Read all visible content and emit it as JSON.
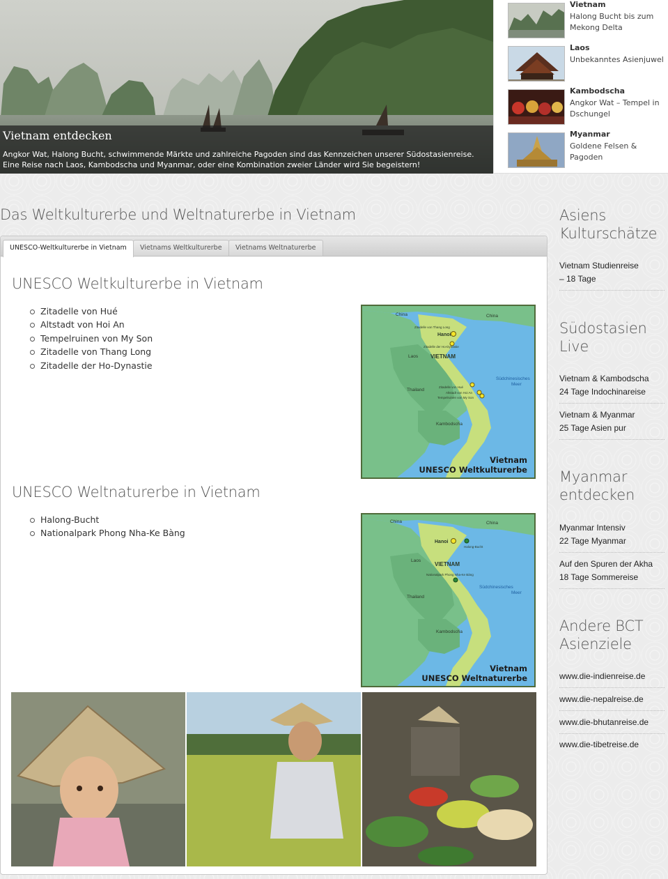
{
  "hero": {
    "title": "Vietnam entdecken",
    "text_line1": "Angkor Wat, Halong Bucht, schwimmende Märkte und zahlreiche Pagoden sind das Kennzeichen unserer Südostasienreise.",
    "text_line2": "Eine Reise nach Laos, Kambodscha und Myanmar, oder eine Kombination zweier Länder wird Sie begeistern!"
  },
  "destinations": [
    {
      "name": "Vietnam",
      "sub": "Halong Bucht bis zum Mekong Delta",
      "thumb": "halong-bay-thumbnail"
    },
    {
      "name": "Laos",
      "sub": "Unbekanntes Asienjuwel",
      "thumb": "laos-temple-thumbnail"
    },
    {
      "name": "Kambodscha",
      "sub": "Angkor Wat – Tempel in Dschungel",
      "thumb": "cambodia-dancers-thumbnail"
    },
    {
      "name": "Myanmar",
      "sub": "Goldene Felsen & Pagoden",
      "thumb": "myanmar-pagoda-thumbnail"
    }
  ],
  "page_title": "Das Weltkulturerbe und Weltnaturerbe in Vietnam",
  "tabs": [
    {
      "label": "UNESCO-Weltkulturerbe in Vietnam",
      "active": true
    },
    {
      "label": "Vietnams Weltkulturerbe",
      "active": false
    },
    {
      "label": "Vietnams Weltnaturerbe",
      "active": false
    }
  ],
  "culture": {
    "title": "UNESCO Weltkulturerbe in Vietnam",
    "items": [
      "Zitadelle von Hué",
      "Altstadt von Hoi An",
      "Tempelruinen von My Son",
      "Zitadelle von Thang Long",
      "Zitadelle der Ho-Dynastie"
    ],
    "map": {
      "caption1": "Vietnam",
      "caption2": "UNESCO  Weltkulturerbe",
      "labels": {
        "china_left": "China",
        "china_right": "China",
        "hanoi": "Hanoi",
        "vietnam": "VIETNAM",
        "laos": "Laos",
        "thailand": "Thailand",
        "kambodscha": "Kambodscha",
        "sea1": "Südchinesisches",
        "sea2": "Meer",
        "thang_long": "Zitadelle von Thang Long",
        "ho": "Zitadelle der Ho-Dynastie",
        "hue": "Zitadelle von Hué",
        "hoi_an": "Altstadt von Hoi An",
        "my_son": "Tempelruinen von My Son"
      }
    }
  },
  "nature": {
    "title": "UNESCO Weltnaturerbe in Vietnam",
    "items": [
      "Halong-Bucht",
      "Nationalpark Phong Nha-Ke Bàng"
    ],
    "map": {
      "caption1": "Vietnam",
      "caption2": "UNESCO  Weltnaturerbe",
      "labels": {
        "china_left": "China",
        "china_right": "China",
        "hanoi": "Hanoi",
        "vietnam": "VIETNAM",
        "laos": "Laos",
        "thailand": "Thailand",
        "kambodscha": "Kambodscha",
        "sea1": "Südchinesisches",
        "sea2": "Meer",
        "halong": "Halong-Bucht",
        "phong_nha": "Nationalpark Phong Nha-Ke Bàng"
      }
    }
  },
  "sidebar": {
    "sections": [
      {
        "heading_line1": "Asiens",
        "heading_line2": "Kulturschätze",
        "links": [
          {
            "line1": "Vietnam Studienreise",
            "line2": "– 18 Tage"
          }
        ]
      },
      {
        "heading_line1": "Südostasien",
        "heading_line2": "Live",
        "links": [
          {
            "line1": "Vietnam & Kambodscha",
            "line2": "24 Tage Indochinareise"
          },
          {
            "line1": "Vietnam & Myanmar",
            "line2": "25 Tage Asien pur"
          }
        ]
      },
      {
        "heading_line1": "Myanmar",
        "heading_line2": "entdecken",
        "links": [
          {
            "line1": "Myanmar Intensiv",
            "line2": "22 Tage Myanmar"
          },
          {
            "line1": "Auf den Spuren der Akha",
            "line2": "18 Tage Sommereise"
          }
        ]
      },
      {
        "heading_line1": "Andere BCT",
        "heading_line2": "Asienziele",
        "links": [
          {
            "line1": "www.die-indienreise.de"
          },
          {
            "line1": "www.die-nepalreise.de"
          },
          {
            "line1": "www.die-bhutanreise.de"
          },
          {
            "line1": "www.die-tibetreise.de"
          }
        ]
      }
    ]
  }
}
